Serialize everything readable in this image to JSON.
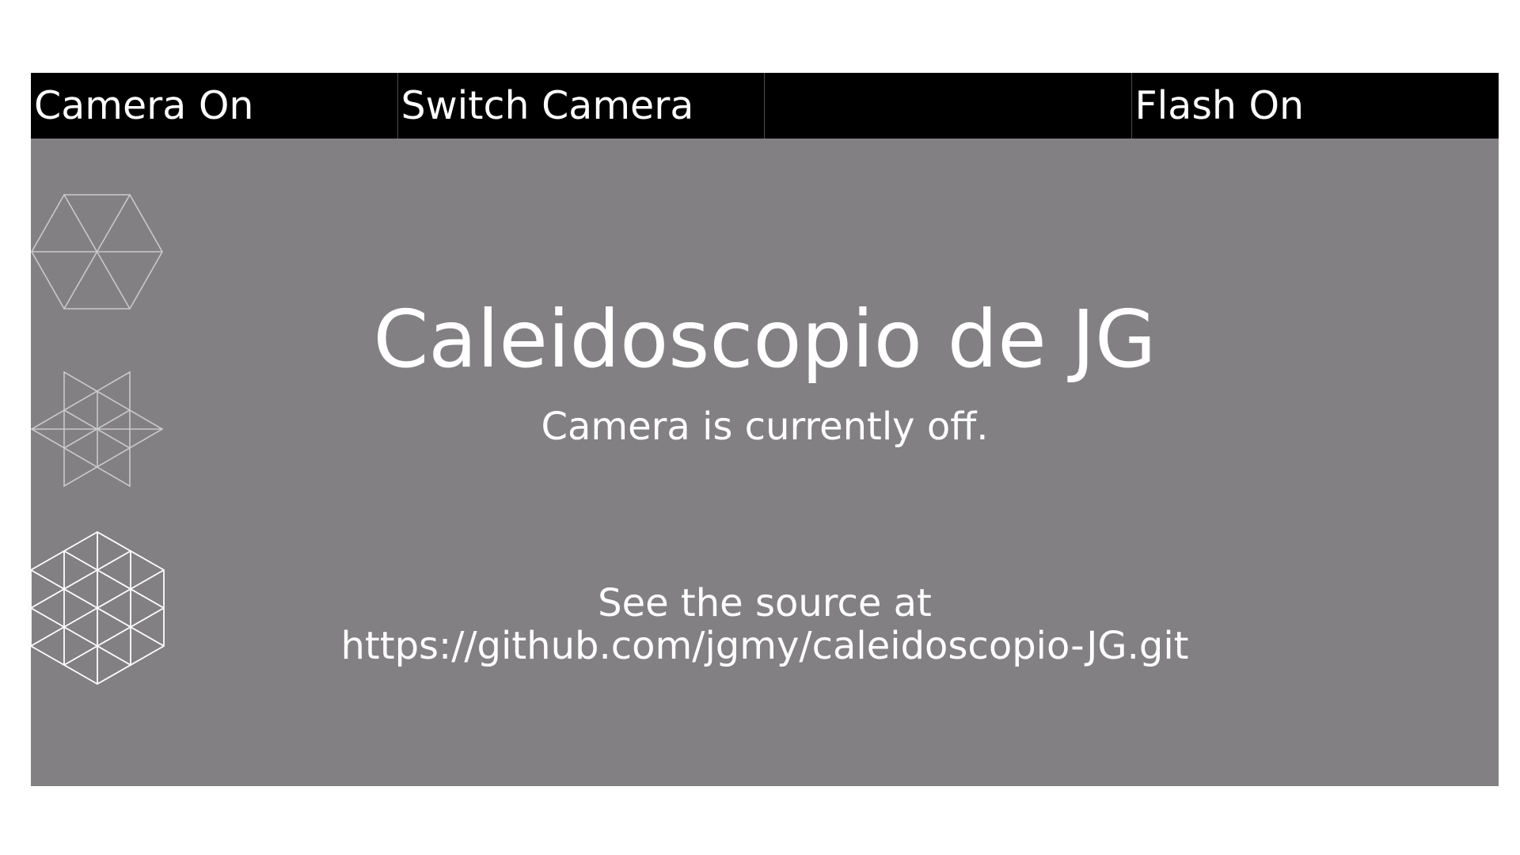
{
  "toolbar": {
    "buttons": [
      {
        "label": "Camera On"
      },
      {
        "label": "Switch Camera"
      },
      {
        "label": ""
      },
      {
        "label": "Flash On"
      }
    ]
  },
  "main": {
    "title": "Caleidoscopio de JG",
    "status": "Camera is currently off.",
    "source_prefix": "See the source at",
    "source_url": "https://github.com/jgmy/caleidoscopio-JG.git"
  },
  "mode_icons": [
    {
      "icon": "hexagon-6-triangles-icon"
    },
    {
      "icon": "hexagram-star-icon"
    },
    {
      "icon": "hexagon-triangle-grid-icon"
    }
  ],
  "colors": {
    "toolbar_bg": "#000000",
    "canvas_bg": "#828083",
    "text": "#ffffff",
    "icon_stroke_light": "#c9c9c9",
    "icon_stroke_bright": "#ffffff"
  }
}
